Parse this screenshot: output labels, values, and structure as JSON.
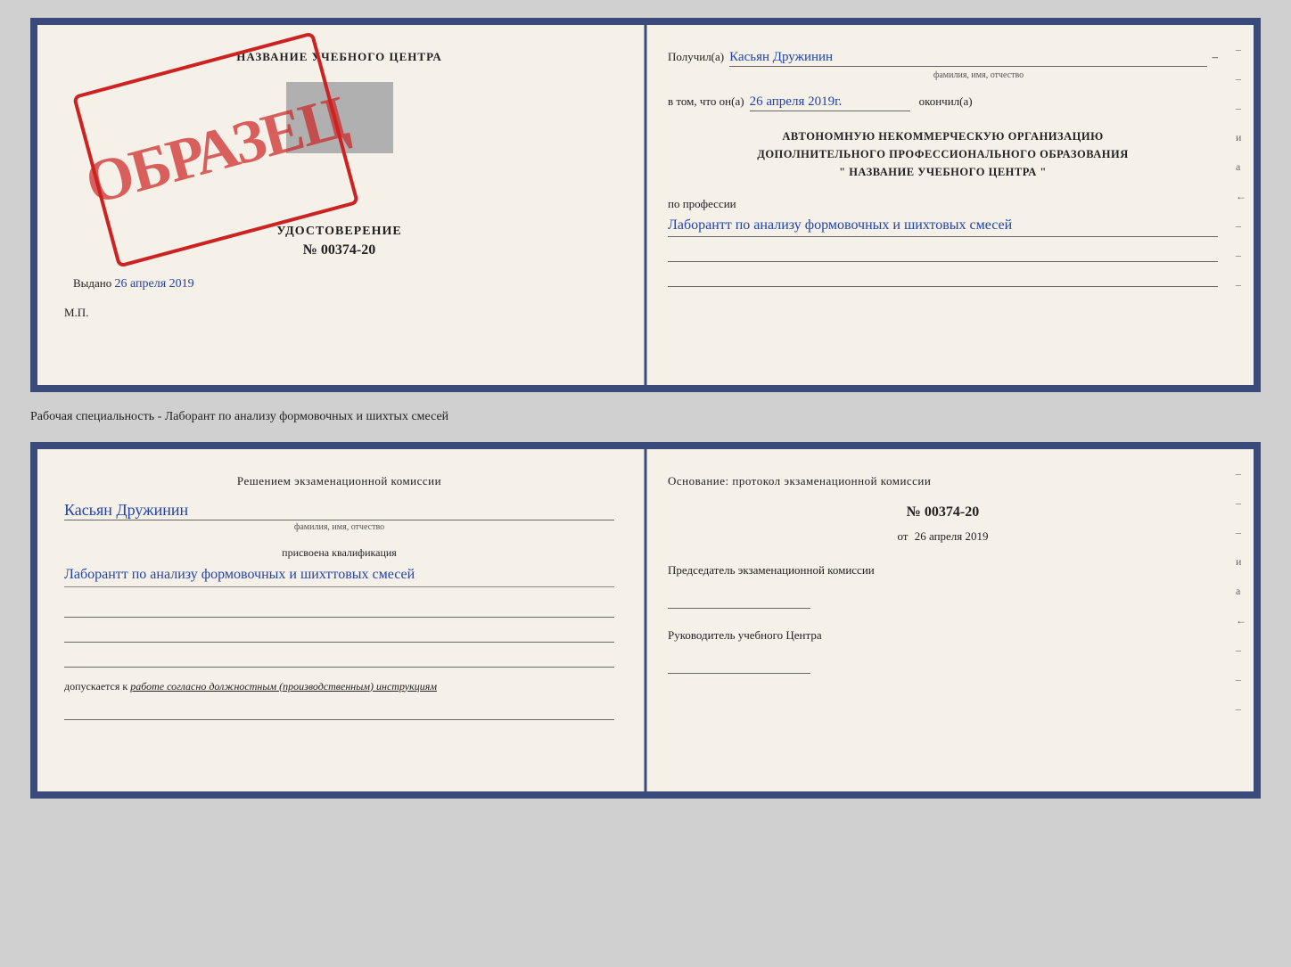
{
  "page1": {
    "left": {
      "title": "НАЗВАНИЕ УЧЕБНОГО ЦЕНТРА",
      "stamp": "ОБРАЗЕЦ",
      "udostoverenie_label": "УДОСТОВЕРЕНИЕ",
      "number": "№ 00374-20",
      "vydano_label": "Выдано",
      "vydano_date": "26 апреля 2019",
      "mp_label": "М.П."
    },
    "right": {
      "poluchil_label": "Получил(а)",
      "poluchil_name": "Касьян Дружинин",
      "fio_sub": "фамилия, имя, отчество",
      "vtom_label": "в том, что он(а)",
      "vtom_date": "26 апреля 2019г.",
      "okonchil_label": "окончил(а)",
      "org_line1": "АВТОНОМНУЮ НЕКОММЕРЧЕСКУЮ ОРГАНИЗАЦИЮ",
      "org_line2": "ДОПОЛНИТЕЛЬНОГО ПРОФЕССИОНАЛЬНОГО ОБРАЗОВАНИЯ",
      "org_line3": "\" НАЗВАНИЕ УЧЕБНОГО ЦЕНТРА \"",
      "po_professii_label": "по профессии",
      "po_professii_value": "Лаборантт по анализу формовочных и шихтовых смесей",
      "side_items": [
        "–",
        "–",
        "–",
        "и",
        "а",
        "←",
        "–",
        "–",
        "–"
      ]
    }
  },
  "specialty_line": "Рабочая специальность - Лаборант по анализу формовочных и шихтых смесей",
  "page2": {
    "left": {
      "header": "Решением экзаменационной комиссии",
      "name_hw": "Касьян Дружинин",
      "fio_sub": "фамилия, имя, отчество",
      "prisvoena_label": "присвоена квалификация",
      "prisvoena_value": "Лаборантт по анализу формовочных и шихттовых смесей",
      "dopuskaetsya_label": "допускается к",
      "dopuskaetsya_value": "работе согласно должностным (производственным) инструкциям"
    },
    "right": {
      "osnovanie_label": "Основание: протокол экзаменационной комиссии",
      "protocol_number": "№ 00374-20",
      "ot_label": "от",
      "ot_date": "26 апреля 2019",
      "predsedatel_label": "Председатель экзаменационной комиссии",
      "rukovoditel_label": "Руководитель учебного Центра",
      "side_items": [
        "–",
        "–",
        "–",
        "и",
        "а",
        "←",
        "–",
        "–",
        "–"
      ]
    }
  }
}
